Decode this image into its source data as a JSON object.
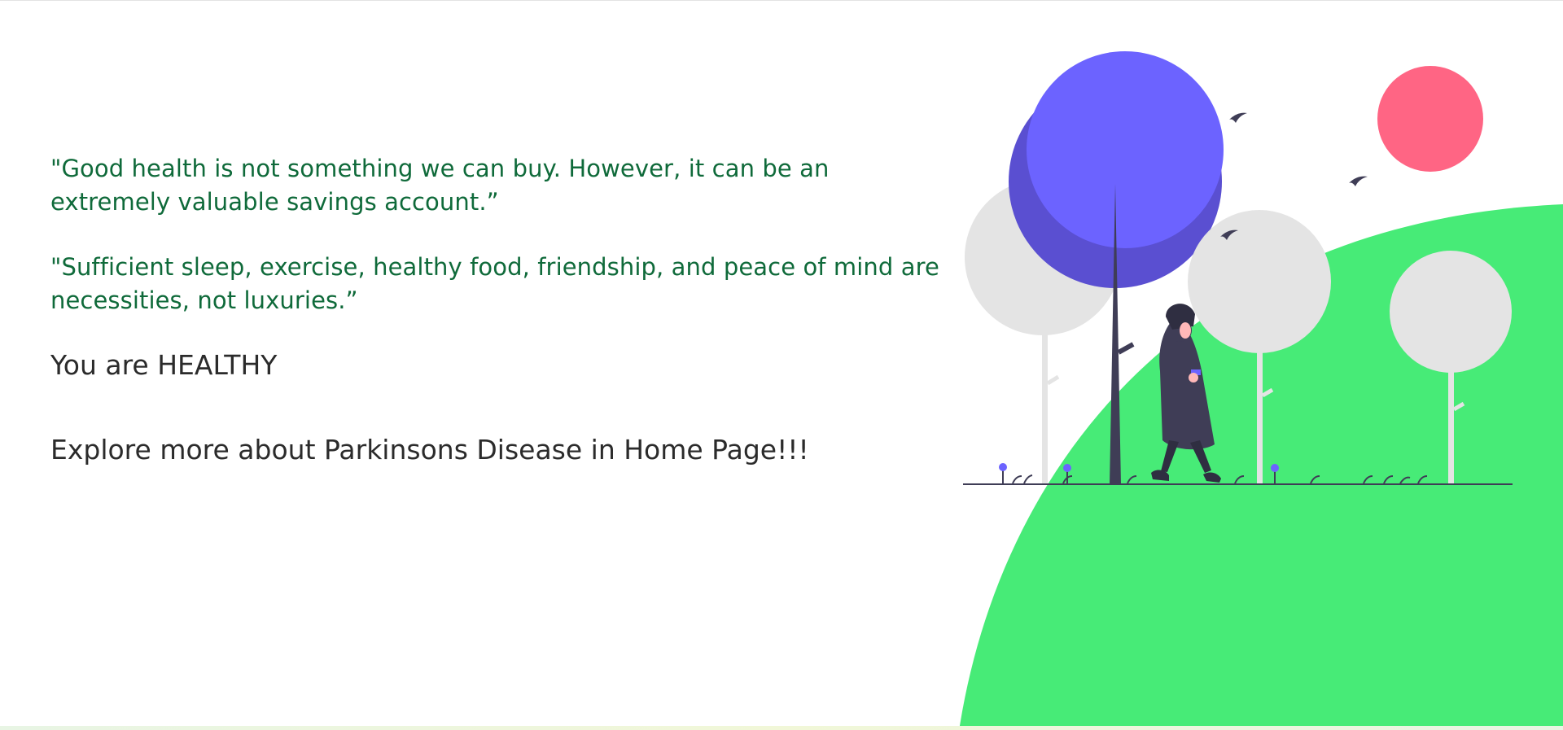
{
  "quotes": [
    "\"Good health is not something we can buy. However, it can be an extremely valuable savings account.”",
    "\"Sufficient sleep, exercise, healthy food, friendship, and peace of mind are necessities, not luxuries.”"
  ],
  "status_text": "You are HEALTHY",
  "explore_text": "Explore more about Parkinsons Disease in Home Page!!!",
  "illustration": {
    "name": "walking-in-park-illustration",
    "colors": {
      "hill": "#47eb77",
      "big_tree": "#6c63ff",
      "big_tree_shadow": "#5a4fd1",
      "trees": "#e4e4e4",
      "sun": "#ff6584",
      "dark": "#3f3d56"
    }
  }
}
